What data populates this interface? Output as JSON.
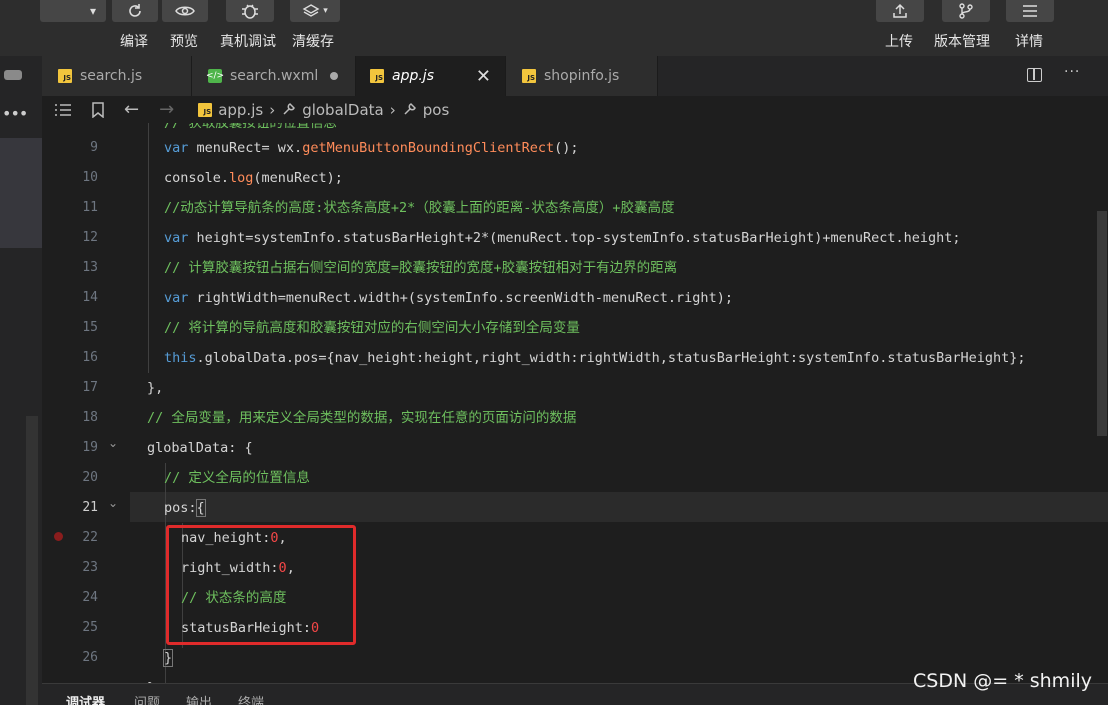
{
  "toolbar": {
    "left_buttons": [
      {
        "label": "编译",
        "icon": "refresh-icon"
      },
      {
        "label": "预览",
        "icon": "eye-icon"
      },
      {
        "label": "真机调试",
        "icon": "bug-icon"
      },
      {
        "label": "清缓存",
        "icon": "layers-icon"
      }
    ],
    "right_buttons": [
      {
        "label": "上传",
        "icon": "upload-icon"
      },
      {
        "label": "版本管理",
        "icon": "branch-icon"
      },
      {
        "label": "详情",
        "icon": "menu-icon"
      }
    ]
  },
  "tabs": [
    {
      "label": "search.js",
      "type": "js"
    },
    {
      "label": "search.wxml",
      "type": "wxml",
      "modified": true
    },
    {
      "label": "app.js",
      "type": "js",
      "active": true
    },
    {
      "label": "shopinfo.js",
      "type": "js"
    }
  ],
  "breadcrumb": {
    "file": "app.js",
    "items": [
      "globalData",
      "pos"
    ]
  },
  "editor": {
    "line_numbers": [
      "9",
      "10",
      "11",
      "12",
      "13",
      "14",
      "15",
      "16",
      "17",
      "18",
      "19",
      "20",
      "21",
      "22",
      "23",
      "24",
      "25",
      "26"
    ],
    "current_line": "21"
  },
  "bottom_panel": {
    "tabs": [
      "调试器",
      "问题",
      "输出",
      "终端"
    ]
  },
  "watermark": "CSDN @= * shmily",
  "colors": {
    "highlight_box": "#e02b2b",
    "keyword": "#569cd6",
    "comment": "#6ec05e"
  }
}
